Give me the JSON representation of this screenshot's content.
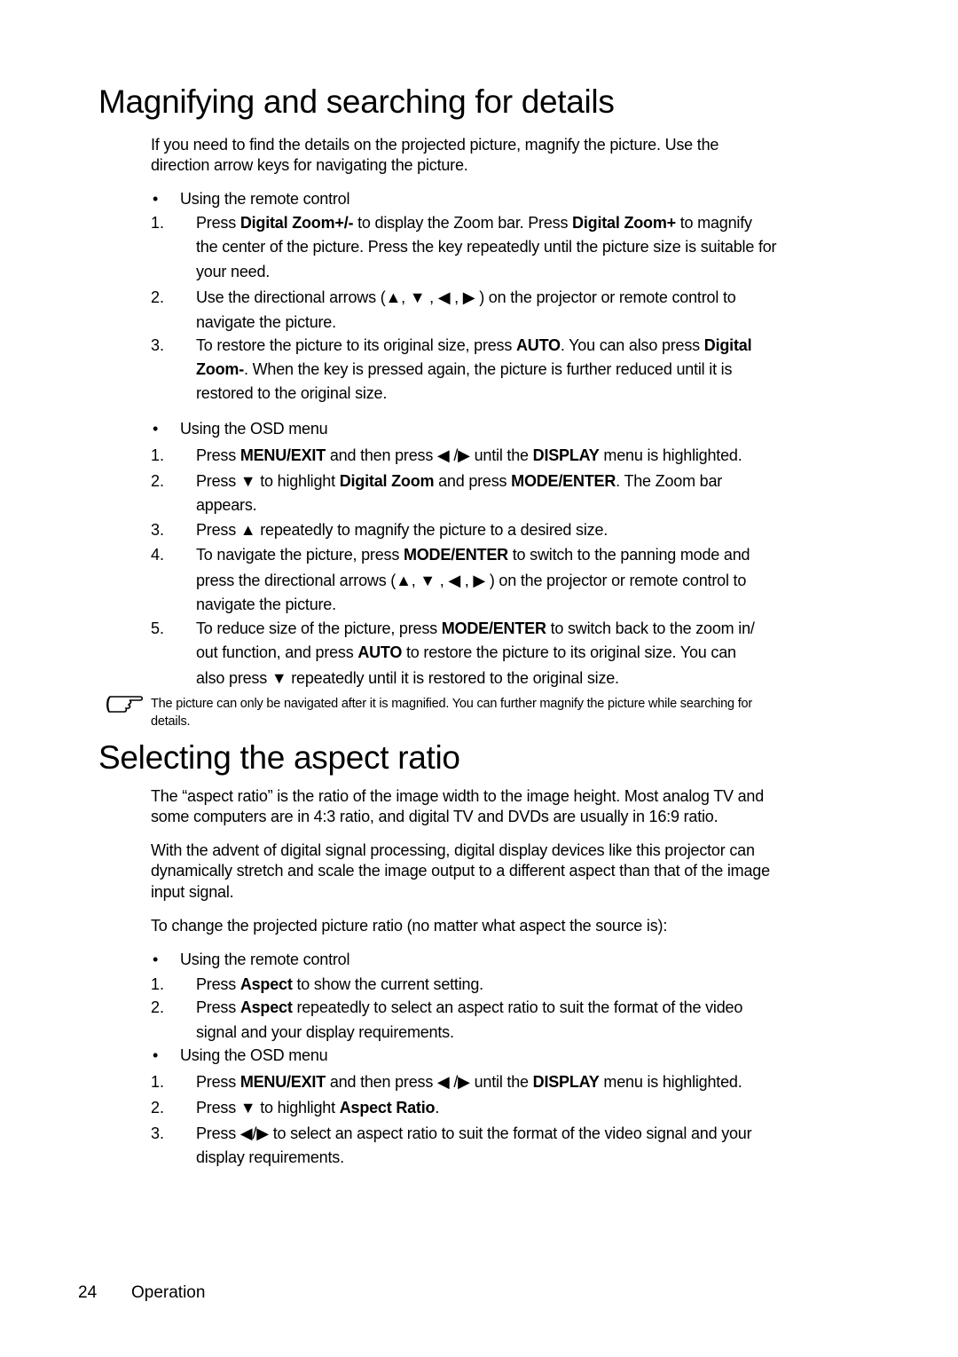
{
  "section1": {
    "title": "Magnifying and searching for details",
    "intro": [
      "If you need to find the details on the projected picture, magnify the picture. Use the",
      "direction arrow keys for navigating the picture."
    ],
    "remote": {
      "bullet": "Using the remote control",
      "steps": [
        {
          "num": "1.",
          "lines": [
            [
              {
                "t": "Press "
              },
              {
                "b": "Digital Zoom+/-"
              },
              {
                "t": " to display the Zoom bar. Press "
              },
              {
                "b": "Digital Zoom+"
              },
              {
                "t": " to magnify"
              }
            ],
            [
              {
                "t": "the center of the picture. Press the key repeatedly until the picture size is suitable for"
              }
            ],
            [
              {
                "t": "your need."
              }
            ]
          ]
        },
        {
          "num": "2.",
          "lines": [
            [
              {
                "t": "Use the directional arrows (▲, ▼ , ◀ , ▶ ) on the projector or remote control to"
              }
            ],
            [
              {
                "t": "navigate the picture."
              }
            ]
          ]
        },
        {
          "num": "3.",
          "lines": [
            [
              {
                "t": "To restore the picture to its original size, press "
              },
              {
                "b": "AUTO"
              },
              {
                "t": ". You can also press "
              },
              {
                "b": "Digital"
              }
            ],
            [
              {
                "b": "Zoom-"
              },
              {
                "t": ". When the key is pressed again, the picture is further reduced until it is"
              }
            ],
            [
              {
                "t": "restored to the original size."
              }
            ]
          ]
        }
      ]
    },
    "osd": {
      "bullet": "Using the OSD menu",
      "steps": [
        {
          "num": "1.",
          "lines": [
            [
              {
                "t": "Press "
              },
              {
                "b": "MENU/EXIT"
              },
              {
                "t": " and then press ◀ /▶  until the "
              },
              {
                "b": "DISPLAY"
              },
              {
                "t": " menu is highlighted."
              }
            ]
          ]
        },
        {
          "num": "2.",
          "lines": [
            [
              {
                "t": "Press ▼ to highlight "
              },
              {
                "b": "Digital Zoom"
              },
              {
                "t": " and press "
              },
              {
                "b": "MODE/ENTER"
              },
              {
                "t": ". The Zoom bar"
              }
            ],
            [
              {
                "t": "appears."
              }
            ]
          ]
        },
        {
          "num": "3.",
          "lines": [
            [
              {
                "t": "Press ▲ repeatedly to magnify the picture to a desired size."
              }
            ]
          ]
        },
        {
          "num": "4.",
          "lines": [
            [
              {
                "t": "To navigate the picture, press "
              },
              {
                "b": "MODE/ENTER"
              },
              {
                "t": " to switch to the panning mode and"
              }
            ],
            [
              {
                "t": "press the directional arrows (▲, ▼ , ◀ , ▶ ) on the projector or remote control to"
              }
            ],
            [
              {
                "t": "navigate the picture."
              }
            ]
          ]
        },
        {
          "num": "5.",
          "lines": [
            [
              {
                "t": "To reduce size of the picture, press "
              },
              {
                "b": "MODE/ENTER"
              },
              {
                "t": " to switch back to the zoom in/"
              }
            ],
            [
              {
                "t": "out function, and press "
              },
              {
                "b": "AUTO"
              },
              {
                "t": " to restore the picture to its original size. You can"
              }
            ],
            [
              {
                "t": "also press ▼  repeatedly until it is restored to the original size."
              }
            ]
          ]
        }
      ]
    },
    "note": [
      "The picture can only be navigated after it is magnified. You can further magnify the picture while searching for",
      "details."
    ],
    "note_icon": "pointing-hand-icon"
  },
  "section2": {
    "title": "Selecting the aspect ratio",
    "paragraphs": [
      [
        "The “aspect ratio” is the ratio of the image width to the image height. Most analog TV and",
        "some computers are in 4:3 ratio, and digital TV and DVDs are usually in 16:9 ratio."
      ],
      [
        "With the advent of digital signal processing, digital display devices like this projector can",
        "dynamically stretch and scale the image output to a different aspect than that of the image",
        "input signal."
      ],
      [
        "To change the projected picture ratio (no matter what aspect the source is):"
      ]
    ],
    "remote": {
      "bullet": "Using the remote control",
      "steps": [
        {
          "num": "1.",
          "lines": [
            [
              {
                "t": "Press "
              },
              {
                "b": "Aspect"
              },
              {
                "t": " to show the current setting."
              }
            ]
          ]
        },
        {
          "num": "2.",
          "lines": [
            [
              {
                "t": "Press "
              },
              {
                "b": "Aspect"
              },
              {
                "t": " repeatedly to select an aspect ratio to suit the format of the video"
              }
            ],
            [
              {
                "t": "signal and your display requirements."
              }
            ]
          ]
        }
      ]
    },
    "osd": {
      "bullet": "Using the OSD menu",
      "steps": [
        {
          "num": "1.",
          "lines": [
            [
              {
                "t": "Press "
              },
              {
                "b": "MENU/EXIT"
              },
              {
                "t": " and then press ◀ /▶  until the "
              },
              {
                "b": "DISPLAY"
              },
              {
                "t": " menu is highlighted."
              }
            ]
          ]
        },
        {
          "num": "2.",
          "lines": [
            [
              {
                "t": "Press ▼ to highlight "
              },
              {
                "b": "Aspect Ratio"
              },
              {
                "t": "."
              }
            ]
          ]
        },
        {
          "num": "3.",
          "lines": [
            [
              {
                "t": "Press ◀/▶ to select an aspect ratio to suit the format of the video signal and your"
              }
            ],
            [
              {
                "t": "display requirements."
              }
            ]
          ]
        }
      ]
    }
  },
  "footer": {
    "page_number": "24",
    "section": "Operation"
  }
}
